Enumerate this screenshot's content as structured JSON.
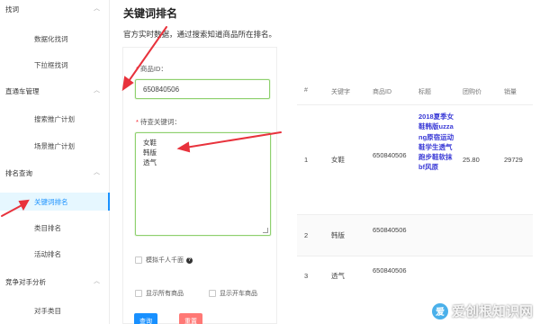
{
  "sidebar": {
    "groups": [
      {
        "label": "找词",
        "items": [
          {
            "label": "数据化找词",
            "active": false
          },
          {
            "label": "下拉框找词",
            "active": false
          }
        ]
      },
      {
        "label": "直通车管理",
        "items": [
          {
            "label": "搜索推广计划",
            "active": false
          },
          {
            "label": "场景推广计划",
            "active": false
          }
        ]
      },
      {
        "label": "排名查询",
        "items": [
          {
            "label": "关键词排名",
            "active": true
          },
          {
            "label": "类目排名",
            "active": false
          },
          {
            "label": "活动排名",
            "active": false
          }
        ]
      },
      {
        "label": "竞争对手分析",
        "items": [
          {
            "label": "对手类目",
            "active": false
          }
        ]
      }
    ]
  },
  "main": {
    "title": "关键词排名",
    "description": "官方实时数据，通过搜索知道商品所在排名。"
  },
  "form": {
    "product_id_label": "商品ID：",
    "product_id_value": "650840506",
    "keywords_label": "待查关键词：",
    "keywords_lines": [
      "女鞋",
      "韩版",
      "透气"
    ],
    "option_simulate": "模拟千人千面",
    "option_show_all": "显示所有商品",
    "option_show_car": "显示开车商品",
    "submit_label": "查询",
    "reset_label": "重置"
  },
  "table": {
    "columns": [
      "#",
      "关键字",
      "商品ID",
      "标题",
      "团购价",
      "销量"
    ],
    "rows": [
      {
        "index": "1",
        "keyword": "女鞋",
        "product_id": "650840506",
        "title": "2018夏季女鞋韩版uzzang原宿运动鞋学生透气跑步鞋软抹bf风原",
        "price": "25.80",
        "sales": "29729"
      },
      {
        "index": "2",
        "keyword": "韩版",
        "product_id": "650840506",
        "title": "",
        "price": "",
        "sales": ""
      },
      {
        "index": "3",
        "keyword": "透气",
        "product_id": "650840506",
        "title": "",
        "price": "",
        "sales": ""
      }
    ]
  },
  "watermark": {
    "text": "爱创根知识网",
    "logo_glyph": "爱"
  },
  "colors": {
    "accent": "#1890ff",
    "annotation_red": "#e8323c",
    "input_border": "#8fd06f",
    "title_link": "#3a3ad6"
  }
}
